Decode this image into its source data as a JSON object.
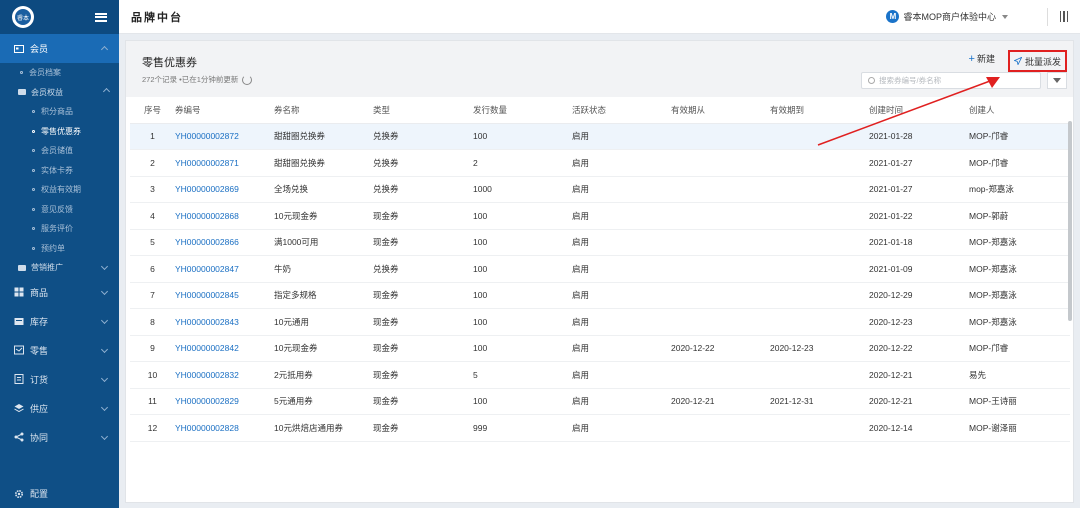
{
  "sidebar": {
    "logo_text": "睿本",
    "groups": [
      {
        "label": "会员"
      },
      {
        "label": "商品"
      },
      {
        "label": "库存"
      },
      {
        "label": "零售"
      },
      {
        "label": "订货"
      },
      {
        "label": "供应"
      },
      {
        "label": "协同"
      }
    ],
    "member_items": [
      {
        "label": "会员档案"
      },
      {
        "label": "会员权益"
      },
      {
        "label": "积分商品"
      },
      {
        "label": "零售优惠券"
      },
      {
        "label": "会员储值"
      },
      {
        "label": "实体卡券"
      },
      {
        "label": "权益有效期"
      },
      {
        "label": "意见反馈"
      },
      {
        "label": "服务评价"
      },
      {
        "label": "预约单"
      },
      {
        "label": "营销推广"
      }
    ],
    "footer": "配置"
  },
  "topbar": {
    "brand": "品牌中台",
    "org_initial": "M",
    "org_name": "睿本MOP商户体验中心"
  },
  "page": {
    "title": "零售优惠券",
    "subtitle": "272个记录 •已在1分钟前更新",
    "new_label": "新建",
    "bulk_label": "批量派发",
    "search_placeholder": "搜索券编号/券名称"
  },
  "table": {
    "headers": [
      "序号",
      "券编号",
      "券名称",
      "类型",
      "发行数量",
      "活跃状态",
      "有效期从",
      "有效期到",
      "创建时间",
      "创建人"
    ],
    "rows": [
      [
        "1",
        "YH00000002872",
        "甜甜圈兑换券",
        "兑换券",
        "100",
        "启用",
        "",
        "",
        "2021-01-28",
        "MOP-邝睿"
      ],
      [
        "2",
        "YH00000002871",
        "甜甜圈兑换券",
        "兑换券",
        "2",
        "启用",
        "",
        "",
        "2021-01-27",
        "MOP-邝睿"
      ],
      [
        "3",
        "YH00000002869",
        "全场兑换",
        "兑换券",
        "1000",
        "启用",
        "",
        "",
        "2021-01-27",
        "mop-郑嘉泳"
      ],
      [
        "4",
        "YH00000002868",
        "10元现金券",
        "现金券",
        "100",
        "启用",
        "",
        "",
        "2021-01-22",
        "MOP-郭蔚"
      ],
      [
        "5",
        "YH00000002866",
        "满1000可用",
        "现金券",
        "100",
        "启用",
        "",
        "",
        "2021-01-18",
        "MOP-郑嘉泳"
      ],
      [
        "6",
        "YH00000002847",
        "牛奶",
        "兑换券",
        "100",
        "启用",
        "",
        "",
        "2021-01-09",
        "MOP-郑嘉泳"
      ],
      [
        "7",
        "YH00000002845",
        "指定多规格",
        "现金券",
        "100",
        "启用",
        "",
        "",
        "2020-12-29",
        "MOP-郑嘉泳"
      ],
      [
        "8",
        "YH00000002843",
        "10元通用",
        "现金券",
        "100",
        "启用",
        "",
        "",
        "2020-12-23",
        "MOP-郑嘉泳"
      ],
      [
        "9",
        "YH00000002842",
        "10元现金券",
        "现金券",
        "100",
        "启用",
        "2020-12-22",
        "2020-12-23",
        "2020-12-22",
        "MOP-邝睿"
      ],
      [
        "10",
        "YH00000002832",
        "2元抵用券",
        "现金券",
        "5",
        "启用",
        "",
        "",
        "2020-12-21",
        "易先"
      ],
      [
        "11",
        "YH00000002829",
        "5元通用券",
        "现金券",
        "100",
        "启用",
        "2020-12-21",
        "2021-12-31",
        "2020-12-21",
        "MOP-王诗丽"
      ],
      [
        "12",
        "YH00000002828",
        "10元烘焙店通用券",
        "现金券",
        "999",
        "启用",
        "",
        "",
        "2020-12-14",
        "MOP-谢泽丽"
      ]
    ]
  },
  "colors": {
    "sidebar_bg": "#0f4f86",
    "active_menu": "#1a6bb5",
    "link": "#1a6fc3",
    "highlight_box": "#e02020"
  }
}
